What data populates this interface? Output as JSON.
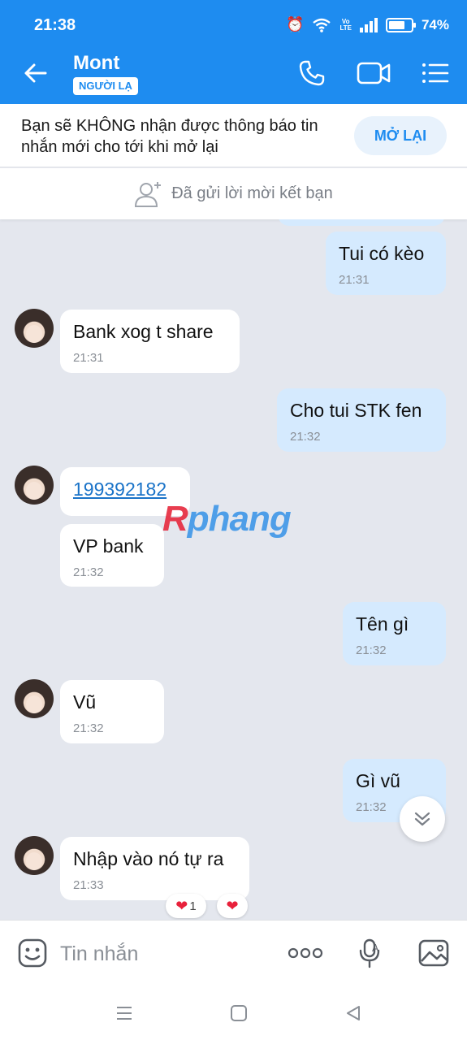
{
  "status_bar": {
    "time": "21:38",
    "battery": "74%",
    "battery_level": 0.74,
    "network_label": "Vo LTE"
  },
  "header": {
    "title": "Mont",
    "badge": "NGƯỜI LẠ",
    "icons": [
      "back-arrow-icon",
      "phone-icon",
      "video-camera-icon",
      "menu-list-icon"
    ]
  },
  "notice": {
    "text": "Bạn sẽ KHÔNG nhận được thông báo tin nhắn mới cho tới khi mở lại",
    "button": "MỞ LẠI"
  },
  "friend_request": {
    "text": "Đã gửi lời mời kết bạn"
  },
  "messages": [
    {
      "dir": "out",
      "text": "Tui có kèo",
      "time": "21:31"
    },
    {
      "dir": "in",
      "text": "Bank xog t share",
      "time": "21:31"
    },
    {
      "dir": "out",
      "text": "Cho tui STK fen",
      "time": "21:32"
    },
    {
      "dir": "in",
      "text": "199392182"
    },
    {
      "dir": "in",
      "text": "VP bank",
      "time": "21:32"
    },
    {
      "dir": "out",
      "text": "Tên gì",
      "time": "21:32"
    },
    {
      "dir": "in",
      "text": "Vũ",
      "time": "21:32"
    },
    {
      "dir": "out",
      "text": "Gì vũ",
      "time": "21:32"
    },
    {
      "dir": "in",
      "text": "Nhập vào nó tự ra",
      "time": "21:33"
    }
  ],
  "reactions": [
    {
      "icon": "heart-icon",
      "count": "1"
    },
    {
      "icon": "heart-icon"
    }
  ],
  "watermark": {
    "first": "R",
    "rest": "phang"
  },
  "composer": {
    "placeholder": "Tin nhắn",
    "icons": [
      "sticker-icon",
      "more-icon",
      "voice-to-text-icon",
      "image-icon"
    ]
  },
  "colors": {
    "primary": "#1e8cf0",
    "outgoing_bubble": "#d5eafe",
    "chat_background": "#e4e7ee",
    "reaction_heart": "#e8213b"
  }
}
